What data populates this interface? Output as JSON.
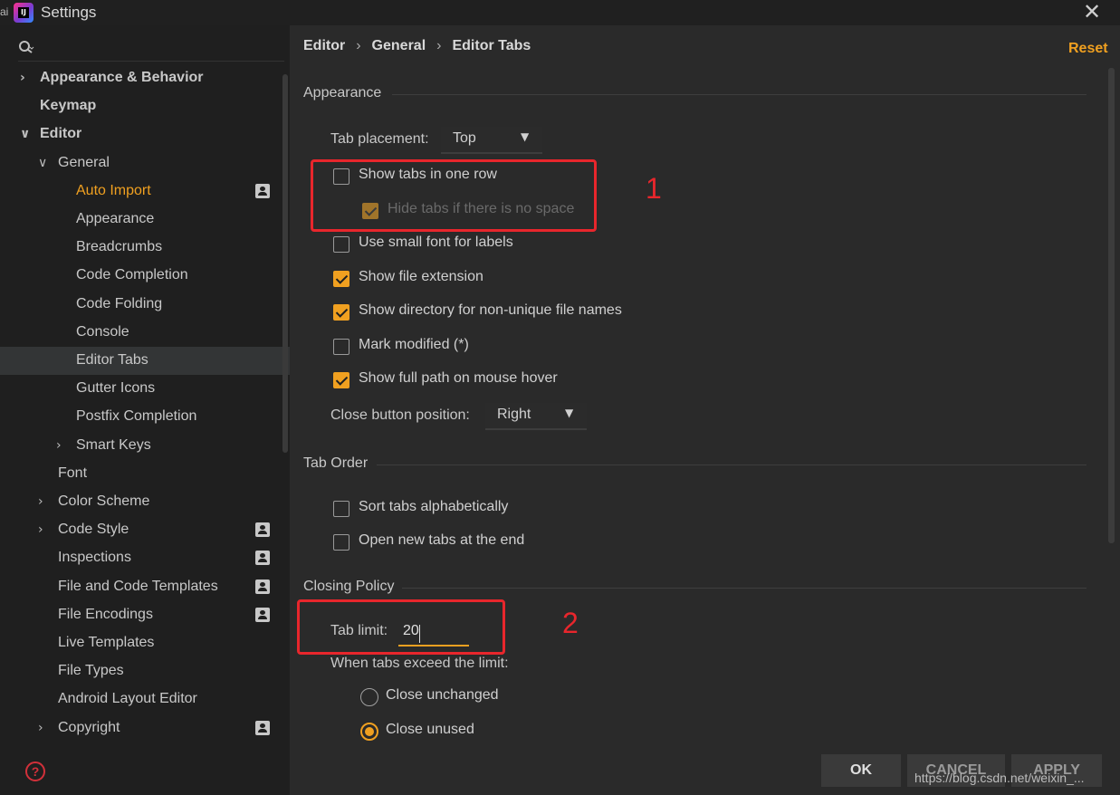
{
  "window": {
    "title": "Settings",
    "close_glyph": "✕",
    "edge_text": "ai",
    "logo_text": "IJ"
  },
  "sidebar": {
    "search_icon": "search-icon",
    "items": [
      {
        "label": "Appearance & Behavior",
        "level": 0,
        "expander": "collapsed",
        "bold": true
      },
      {
        "label": "Keymap",
        "level": 0,
        "bold": true
      },
      {
        "label": "Editor",
        "level": 0,
        "expander": "expanded",
        "bold": true
      },
      {
        "label": "General",
        "level": 1,
        "expander": "expanded"
      },
      {
        "label": "Auto Import",
        "level": 2,
        "highlight": true,
        "project_icon": true
      },
      {
        "label": "Appearance",
        "level": 2
      },
      {
        "label": "Breadcrumbs",
        "level": 2
      },
      {
        "label": "Code Completion",
        "level": 2
      },
      {
        "label": "Code Folding",
        "level": 2
      },
      {
        "label": "Console",
        "level": 2
      },
      {
        "label": "Editor Tabs",
        "level": 2,
        "selected": true
      },
      {
        "label": "Gutter Icons",
        "level": 2
      },
      {
        "label": "Postfix Completion",
        "level": 2
      },
      {
        "label": "Smart Keys",
        "level": 2,
        "expander": "collapsed"
      },
      {
        "label": "Font",
        "level": 1
      },
      {
        "label": "Color Scheme",
        "level": 1,
        "expander": "collapsed"
      },
      {
        "label": "Code Style",
        "level": 1,
        "expander": "collapsed",
        "project_icon": true
      },
      {
        "label": "Inspections",
        "level": 1,
        "project_icon": true
      },
      {
        "label": "File and Code Templates",
        "level": 1,
        "project_icon": true
      },
      {
        "label": "File Encodings",
        "level": 1,
        "project_icon": true
      },
      {
        "label": "Live Templates",
        "level": 1
      },
      {
        "label": "File Types",
        "level": 1
      },
      {
        "label": "Android Layout Editor",
        "level": 1
      },
      {
        "label": "Copyright",
        "level": 1,
        "expander": "collapsed",
        "project_icon": true
      }
    ],
    "help_label": "?"
  },
  "breadcrumb": [
    "Editor",
    "General",
    "Editor Tabs"
  ],
  "breadcrumb_separator": "›",
  "reset_label": "Reset",
  "sections": {
    "appearance": {
      "title": "Appearance",
      "tab_placement_label": "Tab placement:",
      "tab_placement_value": "Top",
      "options": [
        {
          "label": "Show tabs in one row",
          "checked": false
        },
        {
          "label": "Hide tabs if there is no space",
          "checked": true,
          "disabled": true
        },
        {
          "label": "Use small font for labels",
          "checked": false
        },
        {
          "label": "Show file extension",
          "checked": true
        },
        {
          "label": "Show directory for non-unique file names",
          "checked": true
        },
        {
          "label": "Mark modified (*)",
          "checked": false
        },
        {
          "label": "Show full path on mouse hover",
          "checked": true
        }
      ],
      "close_button_label": "Close button position:",
      "close_button_value": "Right"
    },
    "tab_order": {
      "title": "Tab Order",
      "options": [
        {
          "label": "Sort tabs alphabetically",
          "checked": false
        },
        {
          "label": "Open new tabs at the end",
          "checked": false
        }
      ]
    },
    "closing_policy": {
      "title": "Closing Policy",
      "tab_limit_label": "Tab limit:",
      "tab_limit_value": "20",
      "exceed_label": "When tabs exceed the limit:",
      "radios": [
        {
          "label": "Close unchanged",
          "selected": false
        },
        {
          "label": "Close unused",
          "selected": true
        }
      ]
    }
  },
  "annotations": [
    "1",
    "2"
  ],
  "buttons": {
    "ok": "OK",
    "cancel": "CANCEL",
    "apply": "APPLY"
  },
  "watermark": "https://blog.csdn.net/weixin_...",
  "colors": {
    "accent": "#f0a020",
    "annotation": "#e8262c",
    "background": "#2a2a2a",
    "sidebar": "#1f1f1f"
  }
}
